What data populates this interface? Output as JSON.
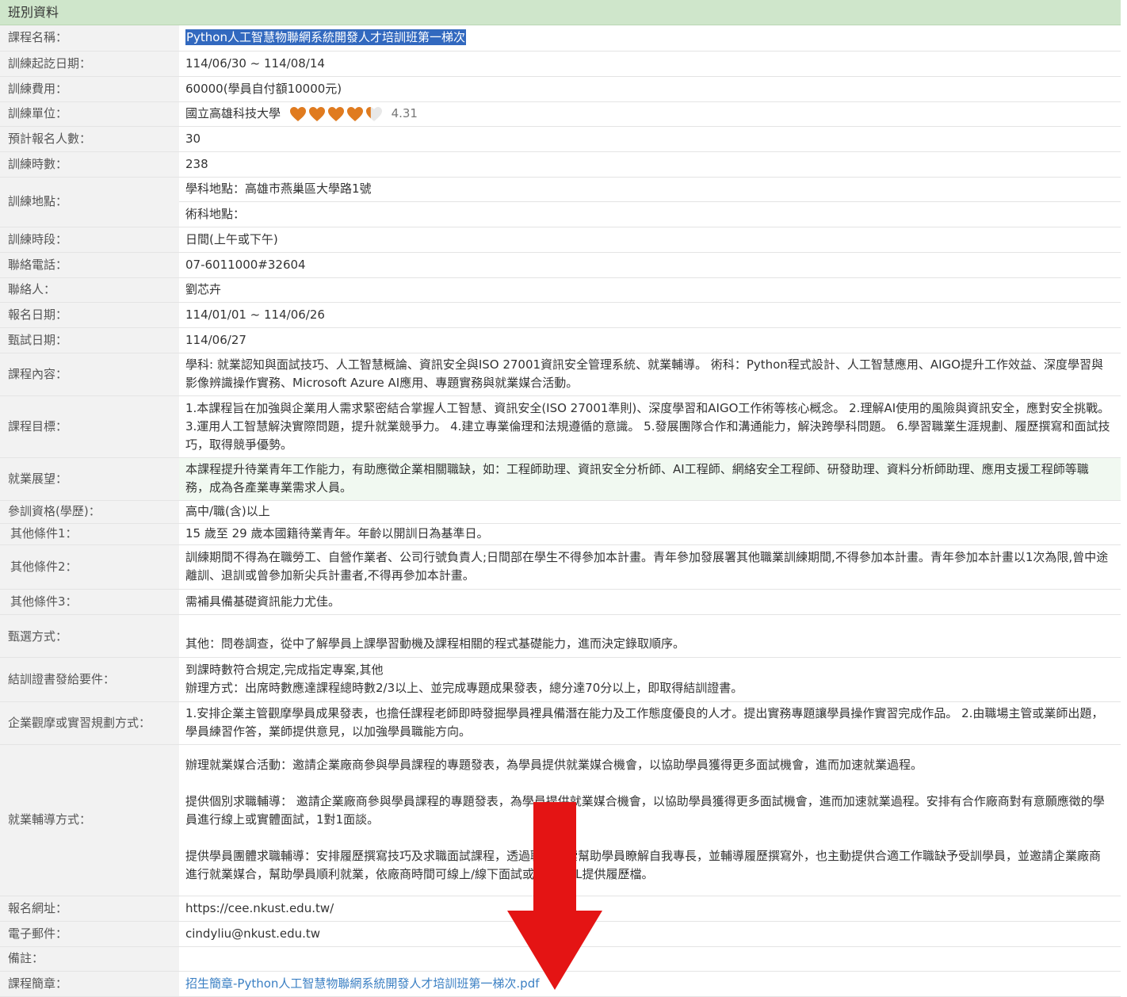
{
  "section_title": "班別資料",
  "course_name": {
    "label": "課程名稱：",
    "value": "Python人工智慧物聯網系統開發人才培訓班第一梯次"
  },
  "training_period": {
    "label": "訓練起訖日期：",
    "value": "114/06/30 ~ 114/08/14"
  },
  "training_fee": {
    "label": "訓練費用：",
    "value": "60000(學員自付額10000元)"
  },
  "training_unit": {
    "label": "訓練單位：",
    "value": "國立高雄科技大學",
    "rating": "4.31",
    "rating_value": 4.31,
    "rating_max": 5,
    "heart_color": "#e07b1f"
  },
  "expected_enrollment": {
    "label": "預計報名人數：",
    "value": "30"
  },
  "training_hours": {
    "label": "訓練時數：",
    "value": "238"
  },
  "location": {
    "label": "訓練地點：",
    "academic": "學科地點：高雄市燕巢區大學路1號",
    "technical": "術科地點："
  },
  "time_slot": {
    "label": "訓練時段：",
    "value": "日間(上午或下午)"
  },
  "phone": {
    "label": "聯絡電話：",
    "value": "07-6011000#32604"
  },
  "contact": {
    "label": "聯絡人：",
    "value": "劉芯卉"
  },
  "registration_period": {
    "label": "報名日期：",
    "value": "114/01/01 ~ 114/06/26"
  },
  "exam_date": {
    "label": "甄試日期：",
    "value": "114/06/27"
  },
  "content": {
    "label": "課程內容：",
    "value": "學科: 就業認知與面試技巧、人工智慧概論、資訊安全與ISO 27001資訊安全管理系統、就業輔導。 術科：Python程式設計、人工智慧應用、AIGO提升工作效益、深度學習與影像辨識操作實務、Microsoft Azure AI應用、專題實務與就業媒合活動。"
  },
  "objectives": {
    "label": "課程目標：",
    "value": "1.本課程旨在加強與企業用人需求緊密結合掌握人工智慧、資訊安全(ISO 27001準則)、深度學習和AIGO工作術等核心概念。 2.理解AI使用的風險與資訊安全，應對安全挑戰。 3.運用人工智慧解決實際問題，提升就業競爭力。 4.建立專業倫理和法規遵循的意識。 5.發展團隊合作和溝通能力，解決跨學科問題。 6.學習職業生涯規劃、履歷撰寫和面試技巧，取得競爭優勢。"
  },
  "prospects": {
    "label": "就業展望：",
    "value": "本課程提升待業青年工作能力，有助應徵企業相關職缺，如：工程師助理、資訊安全分析師、AI工程師、網絡安全工程師、研發助理、資料分析師助理、應用支援工程師等職務，成為各產業專業需求人員。"
  },
  "qualification": {
    "label": "參訓資格(學歷)：",
    "value": "高中/職(含)以上"
  },
  "other1": {
    "label": "其他條件1：",
    "value": "15 歲至 29 歲本國籍待業青年。年齡以開訓日為基準日。"
  },
  "other2": {
    "label": "其他條件2：",
    "value": "訓練期間不得為在職勞工、自營作業者、公司行號負責人;日間部在學生不得參加本計畫。青年參加發展署其他職業訓練期間,不得參加本計畫。青年參加本計畫以1次為限,曾中途離訓、退訓或曾參加新尖兵計畫者,不得再參加本計畫。"
  },
  "other3": {
    "label": "其他條件3：",
    "value": "需補具備基礎資訊能力尤佳。"
  },
  "selection": {
    "label": "甄選方式：",
    "value": "其他：問卷調查，從中了解學員上課學習動機及課程相關的程式基礎能力，進而決定錄取順序。"
  },
  "certificate": {
    "label": "結訓證書發給要件：",
    "line1": "到課時數符合規定,完成指定專案,其他",
    "line2": "辦理方式：出席時數應達課程總時數2/3以上、並完成專題成果發表，總分達70分以上，即取得結訓證書。"
  },
  "visit": {
    "label": "企業觀摩或實習規劃方式：",
    "value": "1.安排企業主管觀摩學員成果發表，也擔任課程老師即時發掘學員裡具備潛在能力及工作態度優良的人才。提出實務專題讓學員操作實習完成作品。 2.由職場主管或業師出題，學員練習作答，業師提供意見，以加強學員職能方向。"
  },
  "employment_counseling": {
    "label": "就業輔導方式：",
    "p1": "辦理就業媒合活動：邀請企業廠商參與學員課程的專題發表，為學員提供就業媒合機會，以協助學員獲得更多面試機會，進而加速就業過程。",
    "p2": "提供個別求職輔導： 邀請企業廠商參與學員課程的專題發表，為學員提供就業媒合機會，以協助學員獲得更多面試機會，進而加速就業過程。安排有合作廠商對有意願應徵的學員進行線上或實體面試，1對1面談。",
    "p3": "提供學員團體求職輔導：安排履歷撰寫技巧及求職面試課程，透過職涯探索幫助學員瞭解自我專長，並輔導履歷撰寫外，也主動提供合適工作職缺予受訓學員，並邀請企業廠商進行就業媒合，幫助學員順利就業，依廠商時間可線上/線下面試或是EMAIL提供履歷檔。"
  },
  "website": {
    "label": "報名網址：",
    "value": "https://cee.nkust.edu.tw/"
  },
  "email": {
    "label": "電子郵件：",
    "value": "cindyliu@nkust.edu.tw"
  },
  "remarks": {
    "label": "備註：",
    "value": ""
  },
  "brochure": {
    "label": "課程簡章：",
    "value": "招生簡章-Python人工智慧物聯網系統開發人才培訓班第一梯次.pdf"
  },
  "colors": {
    "header_bg": "#cfe6cb",
    "label_bg": "#f2f2f2",
    "link": "#3a7fc3",
    "highlight": "#3269bf",
    "arrow": "#e41414"
  }
}
